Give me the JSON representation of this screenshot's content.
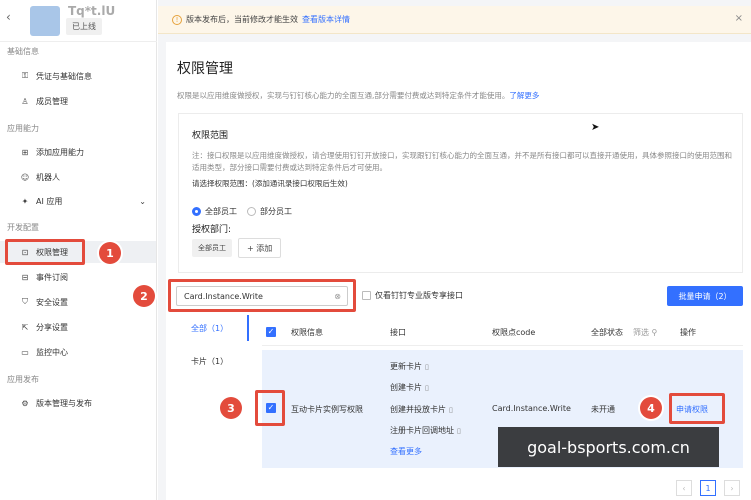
{
  "sidebar": {
    "back": "‹",
    "app_name": "Tq*t.lU",
    "online": "已上线",
    "sections": [
      {
        "title": "基础信息"
      },
      {
        "title": "应用能力"
      },
      {
        "title": "开发配置"
      },
      {
        "title": "应用发布"
      }
    ],
    "items": [
      {
        "label": "凭证与基础信息",
        "icon": "key-icon"
      },
      {
        "label": "成员管理",
        "icon": "user-icon"
      },
      {
        "label": "添加应用能力",
        "icon": "grid-icon"
      },
      {
        "label": "机器人",
        "icon": "robot-icon"
      },
      {
        "label": "AI 应用",
        "icon": "ai-icon"
      },
      {
        "label": "权限管理",
        "icon": "lock-icon"
      },
      {
        "label": "事件订阅",
        "icon": "event-icon"
      },
      {
        "label": "安全设置",
        "icon": "shield-icon"
      },
      {
        "label": "分享设置",
        "icon": "share-icon"
      },
      {
        "label": "监控中心",
        "icon": "monitor-icon"
      },
      {
        "label": "版本管理与发布",
        "icon": "gear-icon"
      }
    ]
  },
  "notice": {
    "text": "版本发布后，当前修改才能生效",
    "link": "查看版本详情",
    "close": "×"
  },
  "page": {
    "title": "权限管理",
    "desc": "权限是以应用维度做授权，实现与钉钉核心能力的全面互通,部分需要付费或达到特定条件才能使用。",
    "desc_link": "了解更多"
  },
  "scope": {
    "title": "权限范围",
    "note": "注：接口权限是以应用维度做授权，请合理使用钉钉开放接口，实现跟钉钉核心能力的全面互通，并不是所有接口都可以直接开通使用，具体参照接口的使用范围和适用类型，部分接口需要付费或达到特定条件后才可使用。",
    "question": "请选择权限范围：(添加通讯录接口权限后生效)",
    "option_all": "全部员工",
    "option_part": "部分员工",
    "dept_label": "授权部门:",
    "dept_tag": "全部员工",
    "add": "+ 添加"
  },
  "toolbar": {
    "search_value": "Card.Instance.Write",
    "pro_only": "仅看钉钉专业版专享接口",
    "batch": "批量申请（2）"
  },
  "categories": [
    {
      "label": "全部（1）"
    },
    {
      "label": "卡片（1）"
    }
  ],
  "table": {
    "headers": {
      "info": "权限信息",
      "api": "接口",
      "code": "权限点code",
      "status": "全部状态",
      "filter": "筛选",
      "action": "操作"
    },
    "row": {
      "name": "互动卡片实例写权限",
      "apis": [
        "更新卡片",
        "创建卡片",
        "创建并投放卡片",
        "注册卡片回调地址"
      ],
      "more": "查看更多",
      "code": "Card.Instance.Write",
      "status": "未开通",
      "action": "申请权限"
    }
  },
  "pager": {
    "prev": "‹",
    "current": "1",
    "next": "›"
  },
  "badges": [
    "1",
    "2",
    "3",
    "4"
  ],
  "watermark": "goal-bsports.com.cn",
  "colors": {
    "accent": "#3370ff",
    "highlight": "#e34b3c"
  }
}
